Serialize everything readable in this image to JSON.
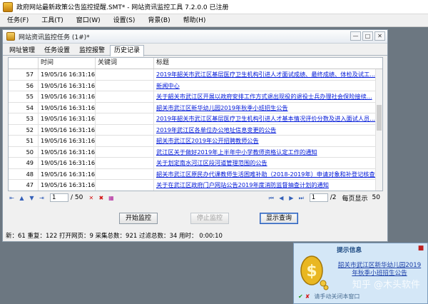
{
  "window": {
    "title": "政府网站最新政策公告监控提醒.SMT* - 网站资讯监控工具 7.2.0.0 已注册"
  },
  "menu": [
    "任务(F)",
    "工具(T)",
    "窗口(W)",
    "设置(S)",
    "背景(B)",
    "帮助(H)"
  ],
  "child": {
    "title": "网站资讯监控任务 (1#)*",
    "tabs": [
      {
        "label": "网址管理",
        "active": false
      },
      {
        "label": "任务设置",
        "active": false
      },
      {
        "label": "监控报警",
        "active": false
      },
      {
        "label": "历史记录",
        "active": true
      }
    ]
  },
  "table": {
    "headers": [
      "",
      "时间",
      "关键词",
      "标题"
    ],
    "rows": [
      {
        "no": "57",
        "time": "19/05/16 16:31:16",
        "kw": "",
        "title": "2019年韶关市武江区基层医疗卫生机构引进人才面试成绩、最终成绩、体检及试工..."
      },
      {
        "no": "56",
        "time": "19/05/16 16:31:16",
        "kw": "",
        "title": "新闻中心"
      },
      {
        "no": "55",
        "time": "19/05/16 16:31:16",
        "kw": "",
        "title": "关于韶关市武江区开展以政府安排工作方式退出现役的退役士兵办理社会保险接续..."
      },
      {
        "no": "54",
        "time": "19/05/16 16:31:16",
        "kw": "",
        "title": "韶关市武江区新华幼儿园2019年秋季小班招生公告"
      },
      {
        "no": "53",
        "time": "19/05/16 16:31:16",
        "kw": "",
        "title": "2019年韶关市武江区基层医疗卫生机构引进人才基本情况评价分数及进入面试人员..."
      },
      {
        "no": "52",
        "time": "19/05/16 16:31:16",
        "kw": "",
        "title": "2019年武江区各单位办公地址信息变更的公告"
      },
      {
        "no": "51",
        "time": "19/05/16 16:31:16",
        "kw": "",
        "title": "韶关市武江区2019年公开招聘教师公告"
      },
      {
        "no": "50",
        "time": "19/05/16 16:31:16",
        "kw": "",
        "title": "武江区关于做好2019年上半年中小学教师资格认定工作的通知"
      },
      {
        "no": "49",
        "time": "19/05/16 16:31:16",
        "kw": "",
        "title": "关于划定南水河江区段河道管理范围的公告"
      },
      {
        "no": "48",
        "time": "19/05/16 16:31:16",
        "kw": "",
        "title": "韶关市武江区原民办代课教师生活困难补助（2018-2019年）申请对象和补登记核查..."
      },
      {
        "no": "47",
        "time": "19/05/16 16:31:16",
        "kw": "",
        "title": "关于在武江区政府门户网站公告2019年度消防监督抽查计划的通知"
      }
    ]
  },
  "pager": {
    "left_page": "1",
    "left_total": "/ 50",
    "right_page": "1",
    "right_total": "/2",
    "per_page_label": "每页显示",
    "per_page_value": "50"
  },
  "buttons": {
    "start": "开始监控",
    "stop": "停止监控",
    "show_query": "显示查询"
  },
  "status": "新：61  重复：122  打开网页：9  采集总数：921  过滤总数：34  用时：  0:00:10",
  "notify": {
    "title": "提示信息",
    "message": "韶关市武江区新华幼儿园2019年秋季小班招生公告",
    "footer": "请手动关闭本窗口",
    "watermark": "知乎 @木头软件"
  }
}
